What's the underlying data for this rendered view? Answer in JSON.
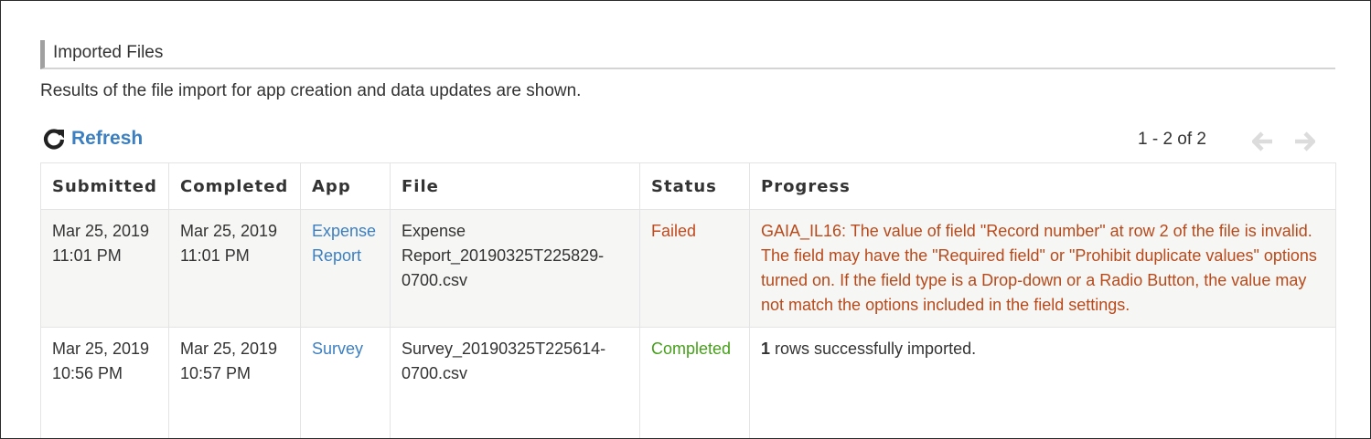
{
  "section": {
    "title": "Imported Files",
    "description": "Results of the file import for app creation and data updates are shown."
  },
  "toolbar": {
    "refresh_label": "Refresh",
    "pager_text": "1 - 2 of 2"
  },
  "table": {
    "headers": [
      "Submitted",
      "Completed",
      "App",
      "File",
      "Status",
      "Progress"
    ],
    "rows": [
      {
        "submitted": "Mar 25, 2019 11:01 PM",
        "completed": "Mar 25, 2019 11:01 PM",
        "app": "Expense Report",
        "file": "Expense Report_20190325T225829-0700.csv",
        "status": "Failed",
        "progress": "GAIA_IL16: The value of field \"Record number\" at row 2 of the file is invalid. The field may have the \"Required field\" or \"Prohibit duplicate values\" options turned on. If the field type is a Drop-down or a Radio Button, the value may not match the options included in the field settings."
      },
      {
        "submitted": "Mar 25, 2019 10:56 PM",
        "completed": "Mar 25, 2019 10:57 PM",
        "app": "Survey",
        "file": "Survey_20190325T225614-0700.csv",
        "status": "Completed",
        "progress_count": "1",
        "progress_text": " rows successfully imported."
      }
    ]
  },
  "colors": {
    "link": "#3c7fc1",
    "failed": "#c24a1e",
    "completed": "#47a01b"
  },
  "icons": {
    "refresh": "refresh-icon",
    "prev": "arrow-left-icon",
    "next": "arrow-right-icon"
  }
}
